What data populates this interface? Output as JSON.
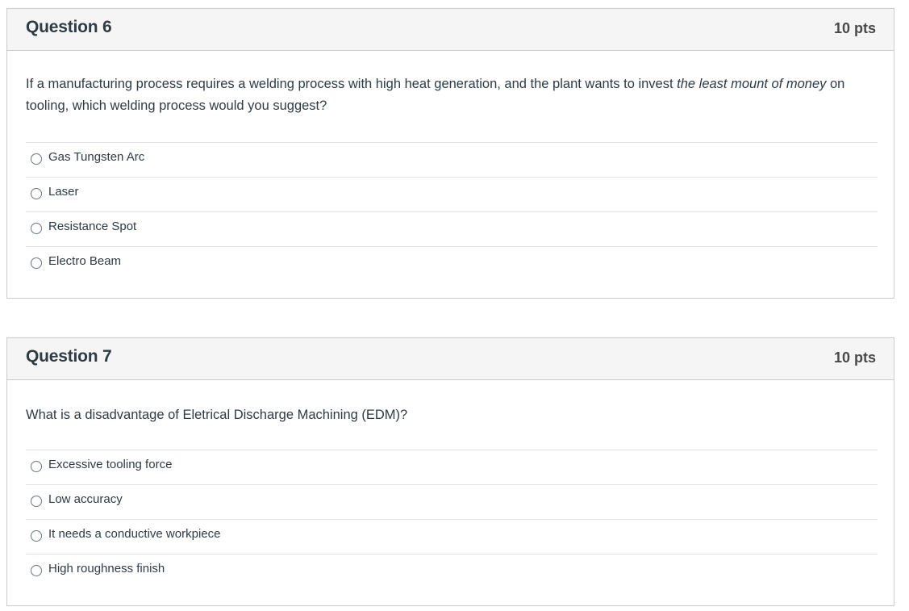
{
  "questions": [
    {
      "title": "Question 6",
      "points": "10 pts",
      "text_parts": {
        "before": "If a manufacturing process requires a welding process with high heat generation, and the plant wants to invest ",
        "emphasis": "the least mount of money",
        "after": " on tooling, which welding process would you suggest?"
      },
      "answers": [
        {
          "label": "Gas Tungsten Arc",
          "selected": false
        },
        {
          "label": "Laser",
          "selected": false
        },
        {
          "label": "Resistance Spot",
          "selected": false
        },
        {
          "label": "Electro Beam",
          "selected": false
        }
      ]
    },
    {
      "title": "Question 7",
      "points": "10 pts",
      "text": "What is a disadvantage of Eletrical Discharge Machining (EDM)?",
      "answers": [
        {
          "label": "Excessive tooling force",
          "selected": false
        },
        {
          "label": "Low accuracy",
          "selected": false
        },
        {
          "label": "It needs a conductive workpiece",
          "selected": false
        },
        {
          "label": "High roughness finish",
          "selected": false
        }
      ]
    }
  ]
}
